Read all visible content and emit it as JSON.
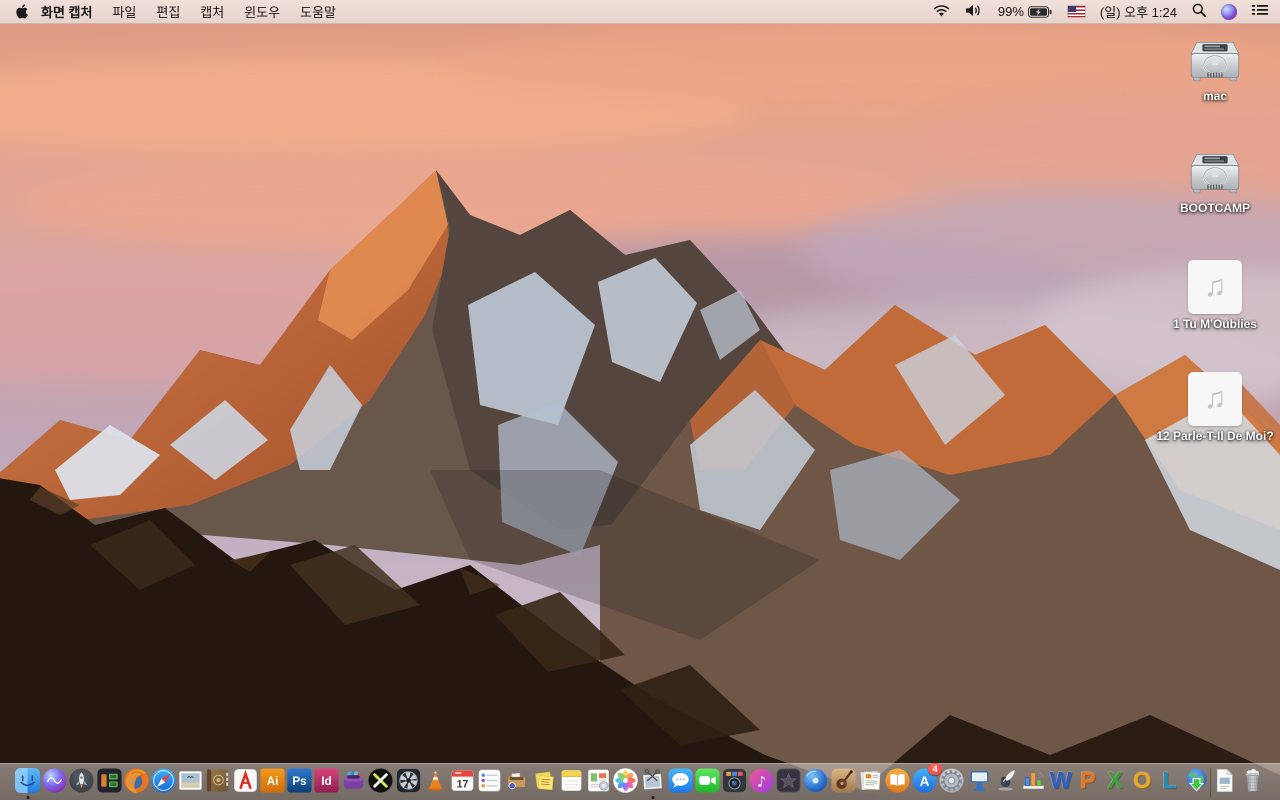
{
  "menu_bar": {
    "app_name": "화면 캡처",
    "menus": [
      "파일",
      "편집",
      "캡처",
      "윈도우",
      "도움말"
    ],
    "status": {
      "battery_percent": "99%",
      "clock": "(일) 오후 1:24"
    }
  },
  "desktop": {
    "music_glyph": "♫",
    "icons": [
      {
        "label": "mac",
        "type": "hard-drive"
      },
      {
        "label": "BOOTCAMP",
        "type": "hard-drive"
      },
      {
        "label": "1 Tu M'Oublies",
        "type": "audio-file"
      },
      {
        "label": "12 Parle-T-Il De Moi?",
        "type": "audio-file"
      }
    ]
  },
  "dock": {
    "glyphs": {
      "illustrator": "Ai",
      "photoshop": "Ps",
      "indesign": "Id",
      "calendar_day": "17",
      "appstore_letter": "A",
      "appstore_badge": "4",
      "itunes_note": "♪",
      "word": "W",
      "powerpoint": "P",
      "excel": "X",
      "outlook": "O",
      "lync": "L"
    },
    "items": [
      "Finder",
      "Siri",
      "Launchpad",
      "Media Tiles App",
      "Firefox",
      "Safari",
      "Photo Viewer",
      "Contacts",
      "Adobe Acrobat",
      "Adobe Illustrator",
      "Adobe Photoshop",
      "Adobe InDesign",
      "Toast",
      "X App",
      "Disk Utility App",
      "VLC",
      "Calendar",
      "Reminders",
      "Archive App",
      "Stickies",
      "Notes",
      "Document Viewer",
      "Photos",
      "Screen Capture (Grab)",
      "Messages",
      "FaceTime",
      "Photo Booth",
      "iTunes",
      "iMovie",
      "DVD Player",
      "GarageBand",
      "News Documents App",
      "iBooks",
      "App Store",
      "System Preferences",
      "Keynote",
      "Pages",
      "Numbers",
      "Microsoft Word",
      "Microsoft PowerPoint",
      "Microsoft Excel",
      "Microsoft Outlook",
      "Microsoft Lync",
      "Globe Downloader",
      "Document File",
      "Trash"
    ],
    "running_apps": [
      "Finder",
      "Screen Capture (Grab)"
    ]
  },
  "colors": {
    "menu_bar_tint": "#ecd9d2",
    "dock_tint": "#b8aca6",
    "badge_red": "#e8413c",
    "desktop_label_text": "#ffffff"
  }
}
